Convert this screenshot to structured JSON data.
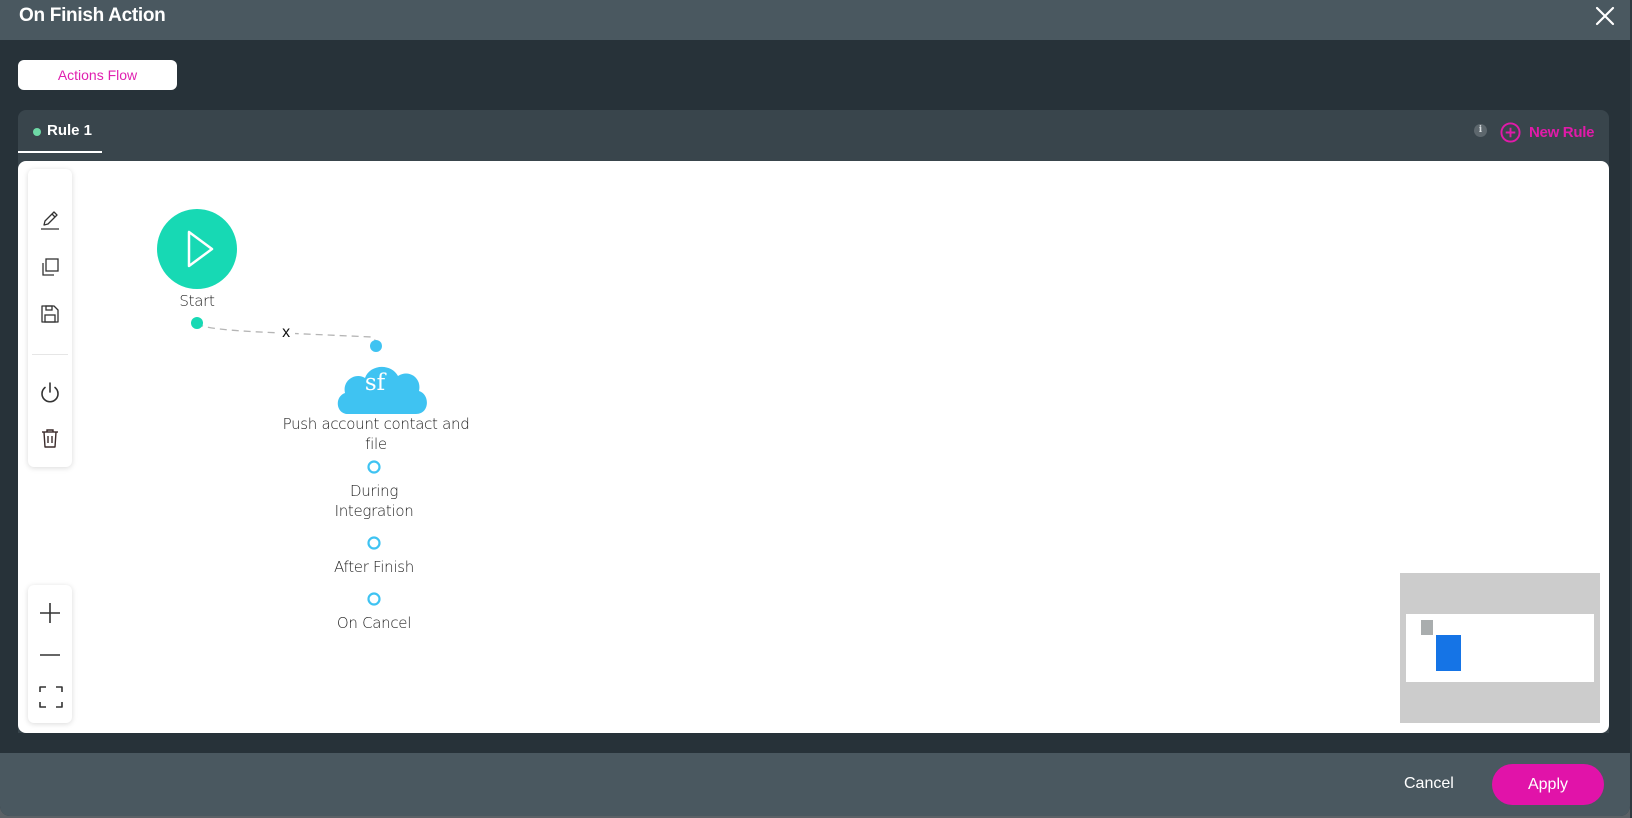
{
  "dialog": {
    "title": "On Finish Action",
    "close_icon": "close-icon"
  },
  "tabs": {
    "actions_flow_label": "Actions Flow"
  },
  "rules": {
    "items": [
      {
        "label": "Rule 1",
        "status_color": "#6ed9a6",
        "active": true
      }
    ],
    "info_glyph": "i",
    "new_rule_label": "New Rule"
  },
  "toolbar": {
    "items": [
      {
        "name": "edit",
        "icon": "pencil-icon"
      },
      {
        "name": "duplicate",
        "icon": "copy-icon"
      },
      {
        "name": "save",
        "icon": "save-icon"
      },
      {
        "name": "toggle",
        "icon": "power-icon"
      },
      {
        "name": "delete",
        "icon": "trash-icon"
      }
    ]
  },
  "zoom_controls": {
    "items": [
      {
        "name": "zoom-in",
        "icon": "plus-icon"
      },
      {
        "name": "zoom-out",
        "icon": "minus-icon"
      },
      {
        "name": "fit-view",
        "icon": "fit-screen-icon"
      }
    ]
  },
  "flow": {
    "start_node": {
      "label": "Start",
      "icon": "play-icon",
      "color": "#17d9b4"
    },
    "connection": {
      "remove_label": "x"
    },
    "action_node": {
      "icon": "salesforce-cloud-icon",
      "icon_text": "sf",
      "color": "#3fc3f2",
      "label_line1": "Push account contact and",
      "label_line2": "file"
    },
    "outputs": [
      {
        "label_line1": "During",
        "label_line2": "Integration"
      },
      {
        "label_line1": "After Finish",
        "label_line2": ""
      },
      {
        "label_line1": "On Cancel",
        "label_line2": ""
      }
    ]
  },
  "footer": {
    "cancel_label": "Cancel",
    "apply_label": "Apply"
  },
  "colors": {
    "accent": "#e113a9",
    "header_bg": "#4a5860",
    "body_bg": "#273239",
    "panel_bg": "#39454c"
  }
}
